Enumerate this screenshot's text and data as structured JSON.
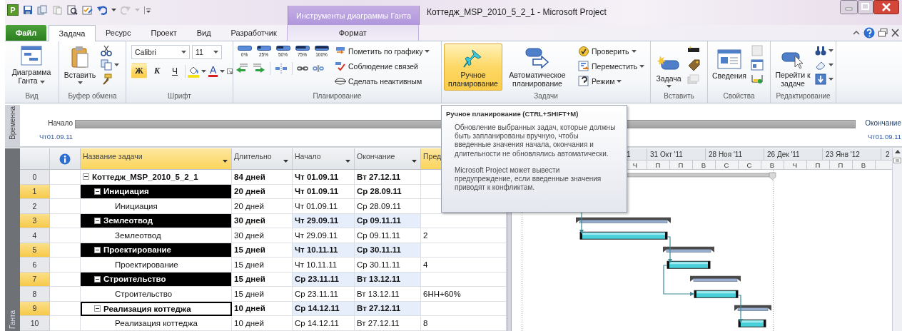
{
  "app_icon": {
    "label": "P"
  },
  "contextual_tab_group": {
    "label": "Инструменты диаграммы Ганта"
  },
  "window": {
    "title": "Коттедж_MSP_2010_5_2_1 - Microsoft Project"
  },
  "tabs": [
    {
      "label": "Файл",
      "kind": "file",
      "selected": false
    },
    {
      "label": "Задача",
      "kind": "normal",
      "selected": true
    },
    {
      "label": "Ресурс",
      "kind": "normal",
      "selected": false
    },
    {
      "label": "Проект",
      "kind": "normal",
      "selected": false
    },
    {
      "label": "Вид",
      "kind": "normal",
      "selected": false
    },
    {
      "label": "Разработчик",
      "kind": "normal",
      "selected": false
    },
    {
      "label": "Формат",
      "kind": "contextual",
      "selected": false
    }
  ],
  "ribbon": {
    "view_group": {
      "label": "Вид",
      "gantt_button": {
        "label": "Диаграмма Ганта"
      }
    },
    "clipboard_group": {
      "label": "Буфер обмена",
      "paste_button": {
        "label": "Вставить"
      }
    },
    "font_group": {
      "label": "Шрифт",
      "font_name": "Calibri",
      "font_size": "11",
      "style_buttons": [
        {
          "label": "Ж",
          "kind": "bold",
          "on": true
        },
        {
          "label": "К",
          "kind": "italic",
          "on": false
        },
        {
          "label": "Ч",
          "kind": "underline",
          "on": false
        }
      ],
      "font_color_button": {
        "label": "A"
      }
    },
    "schedule_group": {
      "label": "Планирование",
      "percent_buttons": [
        "0%",
        "25%",
        "50%",
        "75%",
        "100%"
      ],
      "commands": [
        {
          "label": "Пометить по графику",
          "dropdown": true
        },
        {
          "label": "Соблюдение связей",
          "dropdown": false
        },
        {
          "label": "Сделать неактивным",
          "dropdown": false
        }
      ]
    },
    "tasks_group": {
      "label": "Задачи",
      "mode_buttons": [
        {
          "label": "Ручное планирование",
          "selected": true
        },
        {
          "label": "Автоматическое планирование",
          "selected": false
        }
      ],
      "commands": [
        {
          "label": "Проверить",
          "dropdown": true
        },
        {
          "label": "Переместить",
          "dropdown": true
        },
        {
          "label": "Режим",
          "dropdown": true
        }
      ]
    },
    "insert_group": {
      "label": "Вставить",
      "task_button": {
        "label": "Задача"
      }
    },
    "properties_group": {
      "label": "Свойства",
      "info_button": {
        "label": "Сведения"
      }
    },
    "editing_group": {
      "label": "Редактирование",
      "goto_button": {
        "label": "Перейти к задаче"
      }
    }
  },
  "timeline": {
    "side_label": "Временна",
    "start_label": "Начало",
    "start_date": "Чт01.09.11",
    "end_label": "Окончание",
    "end_date": "Чт01.09.11"
  },
  "table": {
    "side_label": "Ганта",
    "columns": [
      {
        "label": "Название задачи",
        "selected": true,
        "dropdown": true
      },
      {
        "label": "Длительно",
        "selected": false,
        "dropdown": true
      },
      {
        "label": "Начало",
        "selected": false,
        "dropdown": true
      },
      {
        "label": "Окончание",
        "selected": false,
        "dropdown": true
      },
      {
        "label": "Пред",
        "selected": true,
        "dropdown": false
      }
    ],
    "rows": [
      {
        "id": "0",
        "name": "Коттедж_MSP_2010_5_2_1",
        "duration": "84 дней",
        "start": "Чт 01.09.11",
        "finish": "Вт 27.12.11",
        "selected": false,
        "active": false,
        "changed": false,
        "expanded": true,
        "children": [
          {
            "id": "1",
            "name": "Инициация",
            "duration": "20 дней",
            "start": "Чт 01.09.11",
            "finish": "Ср 28.09.11",
            "selected": true,
            "active": false,
            "changed": false,
            "expanded": true,
            "children": [
              {
                "id": "2",
                "name": "Инициация",
                "duration": "20 дней",
                "start": "Чт 01.09.11",
                "finish": "Ср 28.09.11",
                "selected": false,
                "active": false,
                "changed": false
              }
            ]
          },
          {
            "id": "3",
            "name": "Землеотвод",
            "duration": "30 дней",
            "start": "Чт 29.09.11",
            "finish": "Ср 09.11.11",
            "selected": true,
            "active": false,
            "changed": true,
            "expanded": true,
            "children": [
              {
                "id": "4",
                "name": "Землеотвод",
                "duration": "30 дней",
                "start": "Чт 29.09.11",
                "finish": "Ср 09.11.11",
                "predecessors": "2",
                "selected": false,
                "active": false,
                "changed": false
              }
            ]
          },
          {
            "id": "5",
            "name": "Проектирование",
            "duration": "15 дней",
            "start": "Чт 10.11.11",
            "finish": "Ср 30.11.11",
            "selected": true,
            "active": false,
            "changed": true,
            "expanded": true,
            "children": [
              {
                "id": "6",
                "name": "Проектирование",
                "duration": "15 дней",
                "start": "Чт 10.11.11",
                "finish": "Ср 30.11.11",
                "predecessors": "4",
                "selected": false,
                "active": false,
                "changed": false
              }
            ]
          },
          {
            "id": "7",
            "name": "Строительство",
            "duration": "15 дней",
            "start": "Ср 23.11.11",
            "finish": "Вт 13.12.11",
            "selected": true,
            "active": false,
            "changed": true,
            "expanded": true,
            "children": [
              {
                "id": "8",
                "name": "Строительство",
                "duration": "15 дней",
                "start": "Ср 23.11.11",
                "finish": "Вт 13.12.11",
                "predecessors": "6НН+60%",
                "selected": false,
                "active": false,
                "changed": false
              }
            ]
          },
          {
            "id": "9",
            "name": "Реализация коттеджа",
            "duration": "10 дней",
            "start": "Ср 14.12.11",
            "finish": "Вт 27.12.11",
            "selected": true,
            "active": true,
            "changed": true,
            "expanded": true,
            "children": [
              {
                "id": "10",
                "name": "Реализация коттеджа",
                "duration": "10 дней",
                "start": "Ср 14.12.11",
                "finish": "Вт 27.12.11",
                "predecessors": "8",
                "selected": false,
                "active": false,
                "changed": false
              }
            ]
          }
        ]
      }
    ]
  },
  "gantt": {
    "top_tier": [
      "1",
      "31 Окт '11",
      "28 Ноя '11",
      "26 Дек '11",
      "23 Янв '12",
      "2"
    ],
    "bottom_tier": [
      "Ч",
      "П",
      "П",
      "В",
      "С",
      "С",
      "В",
      "Ч",
      "П",
      "П",
      "В"
    ]
  },
  "tooltip": {
    "title": "Ручное планирование (CTRL+SHIFT+M)",
    "paragraphs": [
      "Обновление выбранных задач, которые должны быть запланированы вручную, чтобы введенные значения начала, окончания и длительности не обновлялись автоматически.",
      "Microsoft Project может вывести предупреждение, если введенные значения приводят к конфликтам."
    ]
  }
}
